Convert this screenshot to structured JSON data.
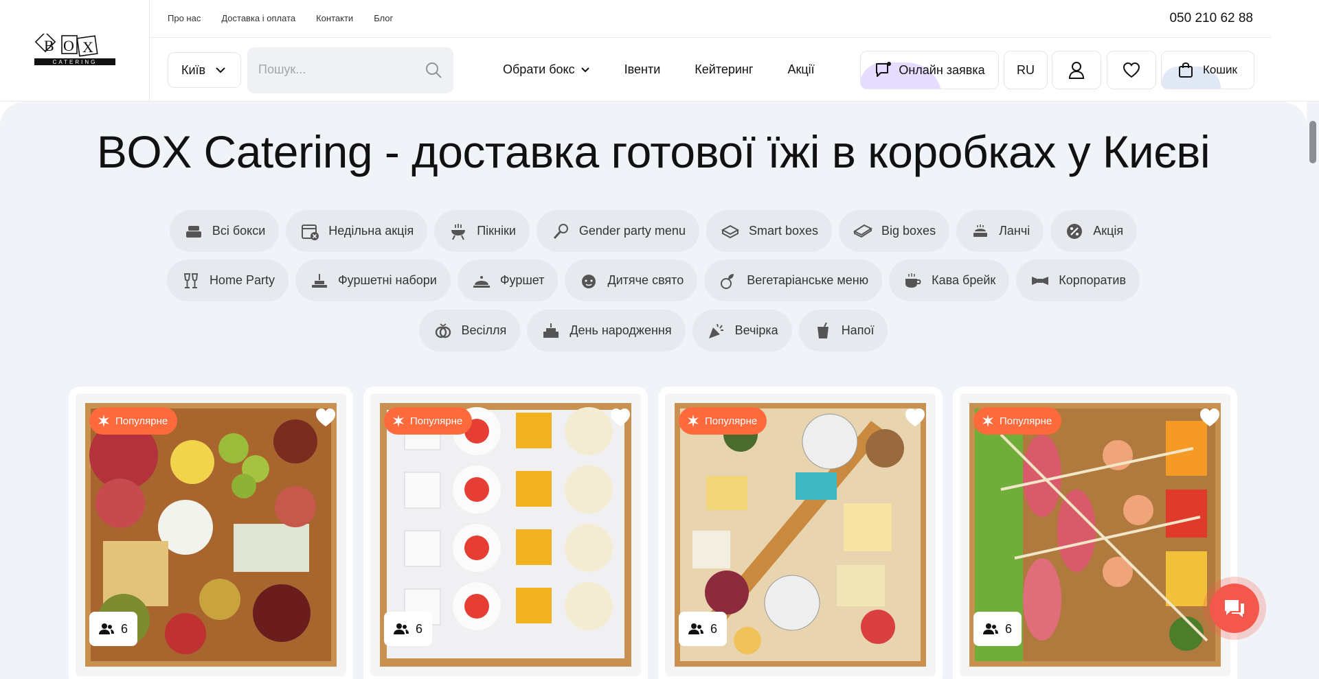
{
  "header": {
    "logo_text": "BOX CATERING",
    "top_links": [
      "Про нас",
      "Доставка і оплата",
      "Контакти",
      "Блог"
    ],
    "phone": "050 210 62 88",
    "city": "Київ",
    "search_placeholder": "Пошук...",
    "nav": [
      {
        "label": "Обрати бокс",
        "dropdown": true
      },
      {
        "label": "Івенти"
      },
      {
        "label": "Кейтеринг"
      },
      {
        "label": "Акції"
      }
    ],
    "online_request": "Онлайн заявка",
    "lang": "RU",
    "cart": "Кошик"
  },
  "page_title": "BOX Catering - доставка готової їжі в коробках у Києві",
  "categories": {
    "row1": [
      {
        "label": "Всі бокси",
        "icon": "boxes-icon"
      },
      {
        "label": "Недільна акція",
        "icon": "calendar-icon"
      },
      {
        "label": "Пікніки",
        "icon": "grill-icon"
      },
      {
        "label": "Gender party menu",
        "icon": "rattle-icon"
      },
      {
        "label": "Smart boxes",
        "icon": "box-icon"
      },
      {
        "label": "Big boxes",
        "icon": "big-box-icon"
      },
      {
        "label": "Ланчі",
        "icon": "lunch-icon"
      },
      {
        "label": "Акція",
        "icon": "discount-icon"
      }
    ],
    "row2": [
      {
        "label": "Home Party",
        "icon": "glasses-icon"
      },
      {
        "label": "Фуршетні набори",
        "icon": "buffet-set-icon"
      },
      {
        "label": "Фуршет",
        "icon": "cloche-icon"
      },
      {
        "label": "Дитяче свято",
        "icon": "child-icon"
      },
      {
        "label": "Вегетаріанське меню",
        "icon": "vegetable-icon"
      },
      {
        "label": "Кава брейк",
        "icon": "coffee-icon"
      },
      {
        "label": "Корпоратив",
        "icon": "bowtie-icon"
      }
    ],
    "row3": [
      {
        "label": "Весілля",
        "icon": "rings-icon"
      },
      {
        "label": "День народження",
        "icon": "cake-icon"
      },
      {
        "label": "Вечірка",
        "icon": "party-popper-icon"
      },
      {
        "label": "Напої",
        "icon": "drink-icon"
      }
    ]
  },
  "products": [
    {
      "badge": "Популярне",
      "people": "6",
      "image": "charcuterie-box"
    },
    {
      "badge": "Популярне",
      "people": "6",
      "image": "dessert-box"
    },
    {
      "badge": "Популярне",
      "people": "6",
      "image": "cheese-box"
    },
    {
      "badge": "Популярне",
      "people": "6",
      "image": "canape-box"
    }
  ],
  "colors": {
    "accent": "#ff6a3d",
    "chat": "#f4574c",
    "content_bg": "#f0f4f8",
    "chip_bg": "#e6e9ee"
  }
}
